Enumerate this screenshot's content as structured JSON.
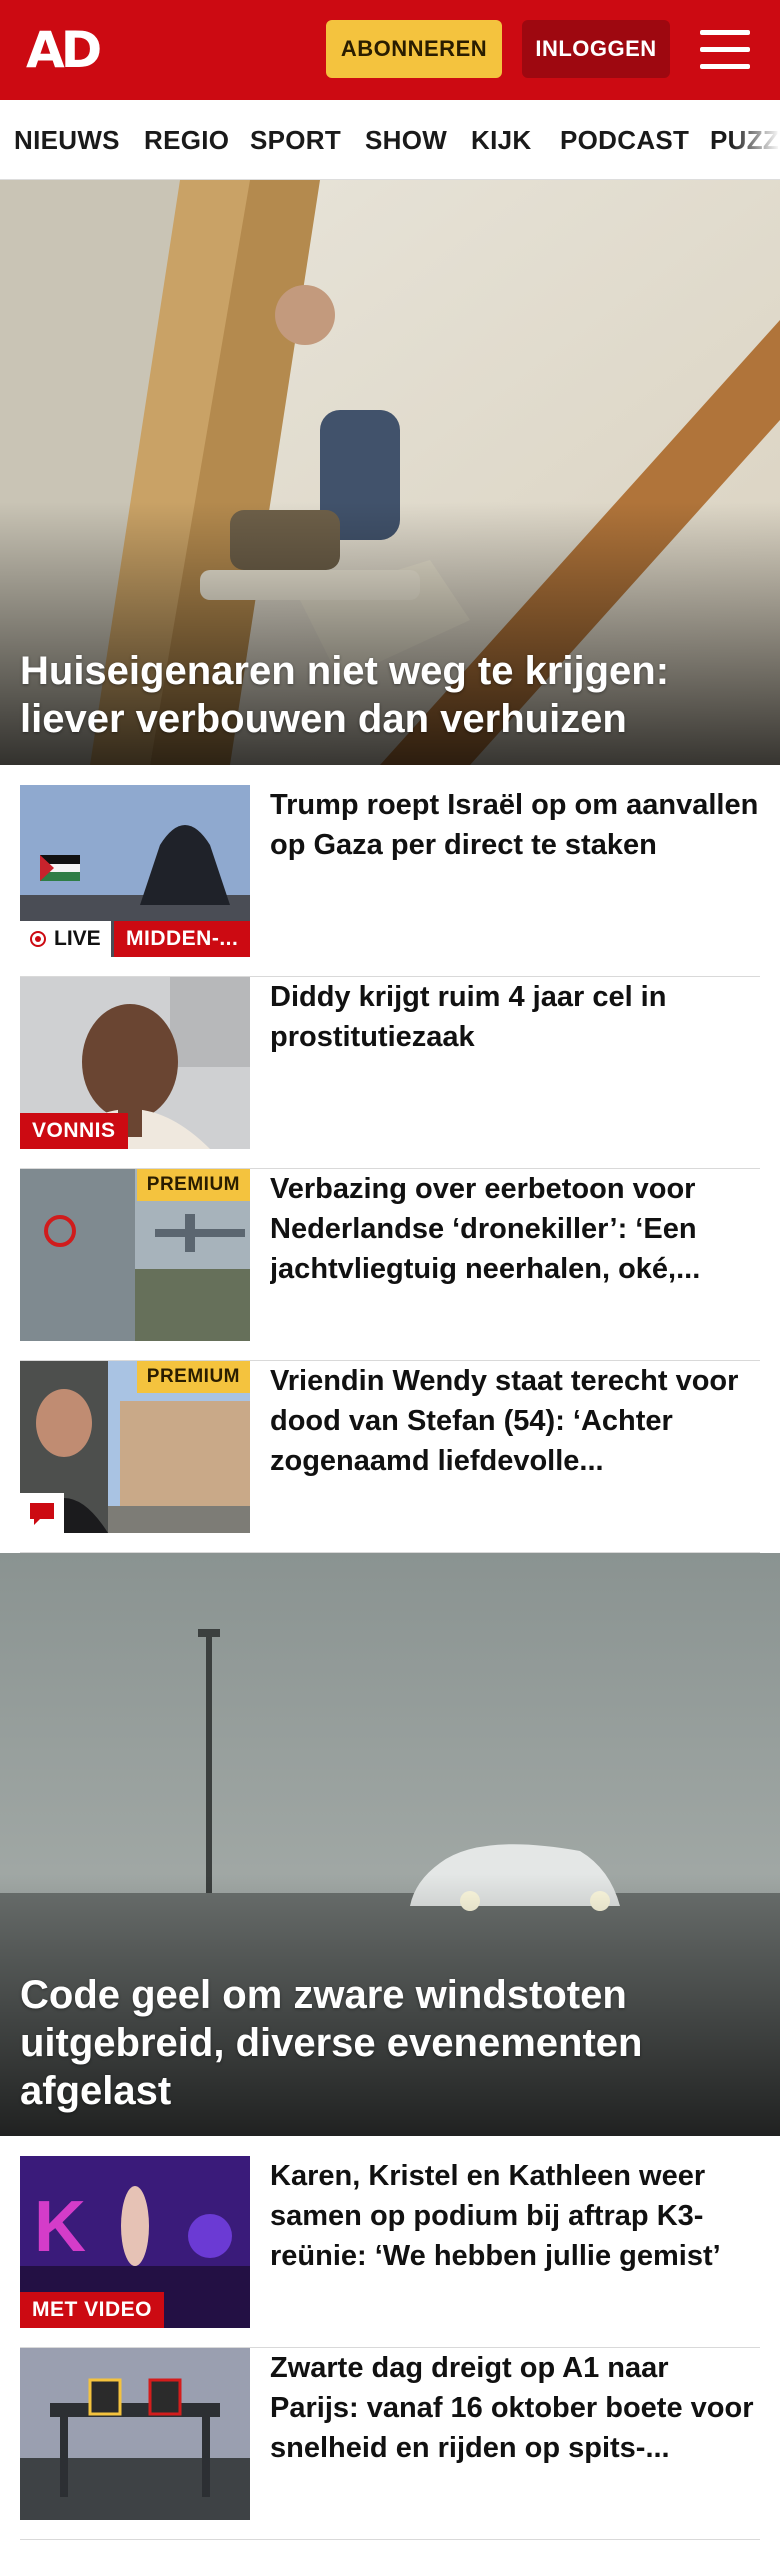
{
  "header": {
    "logo": "AD",
    "subscribe_label": "ABONNEREN",
    "login_label": "INLOGGEN"
  },
  "nav": {
    "items": [
      "NIEUWS",
      "REGIO",
      "SPORT",
      "SHOW",
      "KIJK",
      "PODCAST",
      "PUZZ"
    ]
  },
  "hero1": {
    "title": "Huiseigenaren niet weg te krijgen: lievermverbouwen dan verhuizen"
  },
  "articles1": [
    {
      "title": "Trump roept Israël op om aanvallen op Gaza per direct te staken",
      "badge": "MIDDEN-...",
      "live": "LIVE"
    },
    {
      "title": "Diddy krijgt ruim 4 jaar cel in prostitutiezaak",
      "badge": "VONNIS"
    },
    {
      "title": "Verbazing over eerbetoon voor Nederlandse ‘dronekiller’: ‘Een jachtvliegtuig neerhalen, oké,...",
      "premium": "PREMIUM"
    },
    {
      "title": "Vriendin Wendy staat terecht voor dood van Stefan (54): ‘Achter zogenaamd liefdevolle...",
      "premium": "PREMIUM"
    }
  ],
  "hero2": {
    "title": "Code geel om zware windstoten uitgebreid, diverse evenementen afgelast"
  },
  "articles2": [
    {
      "title": "Karen, Kristel en Kathleen weer samen op podium bij aftrap K3-reünie: ‘We hebben jullie gemist’",
      "badge": "MET VIDEO"
    },
    {
      "title": "Zwarte dag dreigt op A1 naar Parijs: vanaf 16 oktober boete voor snelheid en rijden op spits-..."
    }
  ],
  "colors": {
    "brand_red": "#cc0a12",
    "premium_yellow": "#f4c33e",
    "login_dark_red": "#9e0810"
  },
  "icons": [
    "menu-icon",
    "live-dot-icon",
    "comment-icon"
  ]
}
